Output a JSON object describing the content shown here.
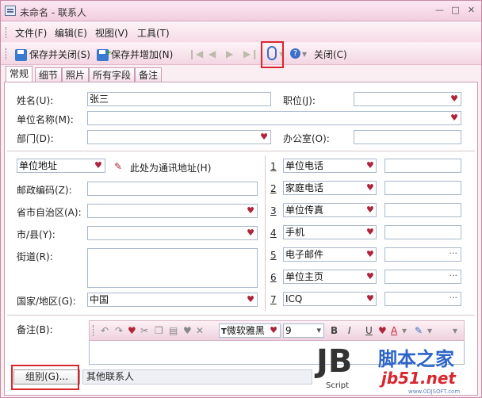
{
  "window": {
    "title": "未命名 - 联系人"
  },
  "menu": [
    "文件(F)",
    "编辑(E)",
    "视图(V)",
    "工具(T)"
  ],
  "toolbar": {
    "save_close": "保存并关闭(S)",
    "save_add": "保存并增加(N)",
    "close": "关闭(C)"
  },
  "tabs": [
    "常规",
    "细节",
    "照片",
    "所有字段",
    "备注"
  ],
  "form": {
    "name_label": "姓名(U):",
    "name_value": "张三",
    "position_label": "职位(J):",
    "company_label": "单位名称(M):",
    "dept_label": "部门(D):",
    "office_label": "办公室(O):",
    "address_type": "单位地址",
    "mailing_label": "此处为通讯地址(H)",
    "postal_label": "邮政编码(Z):",
    "province_label": "省市自治区(A):",
    "city_label": "市/县(Y):",
    "street_label": "街道(R):",
    "country_label": "国家/地区(G):",
    "country_value": "中国",
    "notes_label": "备注(B):"
  },
  "phones": [
    {
      "num": "1",
      "label": "单位电话"
    },
    {
      "num": "2",
      "label": "家庭电话"
    },
    {
      "num": "3",
      "label": "单位传真"
    },
    {
      "num": "4",
      "label": "手机"
    },
    {
      "num": "5",
      "label": "电子邮件"
    },
    {
      "num": "6",
      "label": "单位主页"
    },
    {
      "num": "7",
      "label": "ICQ"
    }
  ],
  "notes_toolbar": {
    "font": "微软雅黑",
    "size": "9"
  },
  "footer": {
    "group_button": "组别(G)...",
    "group_value": "其他联系人"
  },
  "watermark": {
    "logo": "JB",
    "script": "Script",
    "cn": "脚本之家",
    "url": "jb51.net",
    "sub": "www.0DJSOFT.com"
  }
}
